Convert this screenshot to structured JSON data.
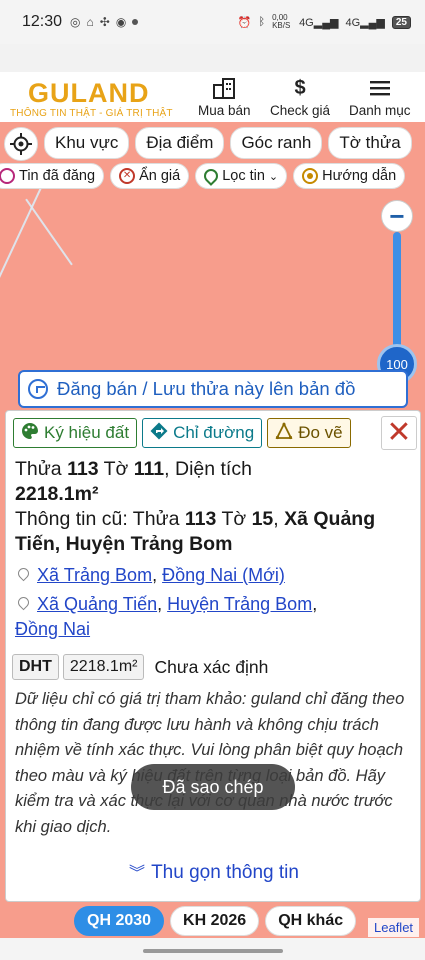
{
  "status_bar": {
    "time": "12:30",
    "network_speed": "0,00\nKB/S",
    "signal1": "4G",
    "signal2": "4G",
    "battery": "25"
  },
  "header": {
    "brand": "GULAND",
    "tagline": "THÔNG TIN THẬT - GIÁ TRỊ THẬT",
    "nav": [
      {
        "label": "Mua bán",
        "icon": "building-icon"
      },
      {
        "label": "Check giá",
        "icon": "dollar-icon"
      },
      {
        "label": "Danh mục",
        "icon": "menu-icon"
      }
    ]
  },
  "filters_row1": [
    "Khu vực",
    "Địa điểm",
    "Góc ranh",
    "Tờ thửa"
  ],
  "filters_row2": [
    "Tin đã đăng",
    "Ẩn giá",
    "Lọc tin",
    "Hướng dẫn"
  ],
  "zoom": {
    "level": "100",
    "minus": "−"
  },
  "publish_bar": {
    "label": "Đăng bán / Lưu thửa này lên bản đồ"
  },
  "panel": {
    "actions": [
      "Ký hiệu đất",
      "Chỉ đường",
      "Đo vẽ"
    ],
    "close": "✕",
    "parcel": {
      "thua_label": "Thửa",
      "thua": "113",
      "to_label": "Tờ",
      "to": "111",
      "area_label": "Diện tích",
      "area": "2218.1m²"
    },
    "old_info": {
      "prefix": "Thông tin cũ: Thửa",
      "thua": "113",
      "to_label": "Tờ",
      "to": "15",
      "location": "Xã Quảng Tiến, Huyện Trảng Bom"
    },
    "address_new": {
      "commune": "Xã Trảng Bom",
      "province": "Đồng Nai (Mới)"
    },
    "address_old": {
      "commune": "Xã Quảng Tiến",
      "district": "Huyện Trảng Bom",
      "province": "Đồng Nai"
    },
    "tags": {
      "type": "DHT",
      "area": "2218.1m²",
      "status": "Chưa xác định"
    },
    "disclaimer": "Dữ liệu chỉ có giá trị tham khảo: guland chỉ đăng theo thông tin đang được lưu hành và không chịu trách nhiệm về tính xác thực. Vui lòng phân biệt quy hoạch theo màu và ký hiệu đất trên từng loại bản đồ. Hãy kiểm tra và xác thực lại với cơ quan nhà nước trước khi giao dịch.",
    "collapse": "Thu gọn thông tin"
  },
  "toast": "Đã sao chép",
  "layer_tabs": [
    "QH 2030",
    "KH 2026",
    "QH khác"
  ],
  "attribution": "Leaflet",
  "colors": {
    "map": "#f79d8c",
    "brand": "#e8a317",
    "primary": "#2f6fd4",
    "link": "#2246c8"
  }
}
